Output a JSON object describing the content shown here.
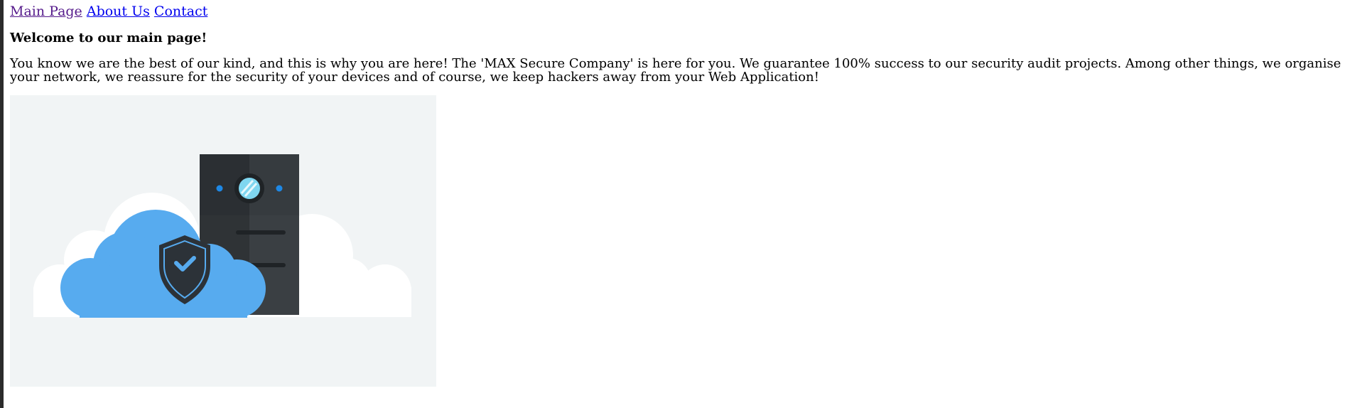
{
  "nav": {
    "links": [
      {
        "label": "Main Page",
        "visited": true
      },
      {
        "label": "About Us",
        "visited": false
      },
      {
        "label": "Contact",
        "visited": false
      }
    ]
  },
  "main": {
    "heading": "Welcome to our main page!",
    "intro": "You know we are the best of our kind, and this is why you are here! The 'MAX Secure Company' is here for you. We guarantee 100% success to our security audit projects. Among other things, we organise your network, we reassure for the security of your devices and of course, we keep hackers away from your Web Application!"
  },
  "hero_image": {
    "icons": [
      "cloud-icon",
      "server-icon",
      "shield-check-icon"
    ],
    "colors": {
      "background": "#f1f4f5",
      "cloud_back": "#ffffff",
      "cloud_front": "#57abef",
      "server": "#2f3336",
      "server_light": "#3b4044",
      "shield": "#2c3238",
      "accent_blue": "#1e88e5",
      "lens": "#7fd6f0"
    }
  }
}
